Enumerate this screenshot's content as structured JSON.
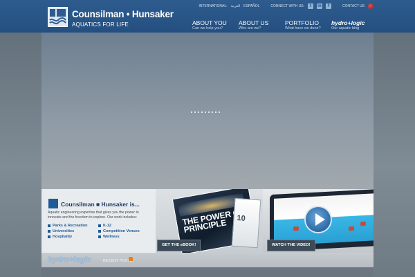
{
  "header": {
    "brand": "Counsilman • Hunsaker",
    "tagline": "AQUATICS FOR LIFE",
    "topbar": {
      "international_label": "INTERNATIONAL:",
      "arabic_label": "العربية",
      "spanish_label": "ESPAÑOL",
      "connect_label": "CONNECT WITH US:",
      "contact_label": "CONTACT US"
    },
    "nav": [
      {
        "title": "ABOUT YOU",
        "subtitle": "Can we help you?"
      },
      {
        "title": "ABOUT US",
        "subtitle": "Who are we?"
      },
      {
        "title": "PORTFOLIO",
        "subtitle": "What have we done?"
      },
      {
        "title": "hydro+logic",
        "subtitle": "Our aquatic blog"
      }
    ]
  },
  "promo": {
    "title": "Counsilman ■ Hunsaker is...",
    "description": "Aquatic engineering expertise that gives you the power to innovate and the freedom to explore. Our work includes:",
    "items": [
      "Parks & Recreation",
      "Universities",
      "Hospitality",
      "K-12",
      "Competition Venues",
      "Wellness"
    ],
    "ebook_headline": "THE POWER OF PRINCIPLE",
    "ebook_side_text": "10",
    "ebook_button": "GET THE eBOOK!",
    "video_button": "WATCH THE VIDEO!"
  },
  "blog": {
    "logo": "hydro+logic",
    "recent_label": "RECENT POSTS"
  },
  "colors": {
    "header_blue": "#2b5a8c",
    "link_blue": "#1f5a98",
    "rss_orange": "#e8811c"
  }
}
